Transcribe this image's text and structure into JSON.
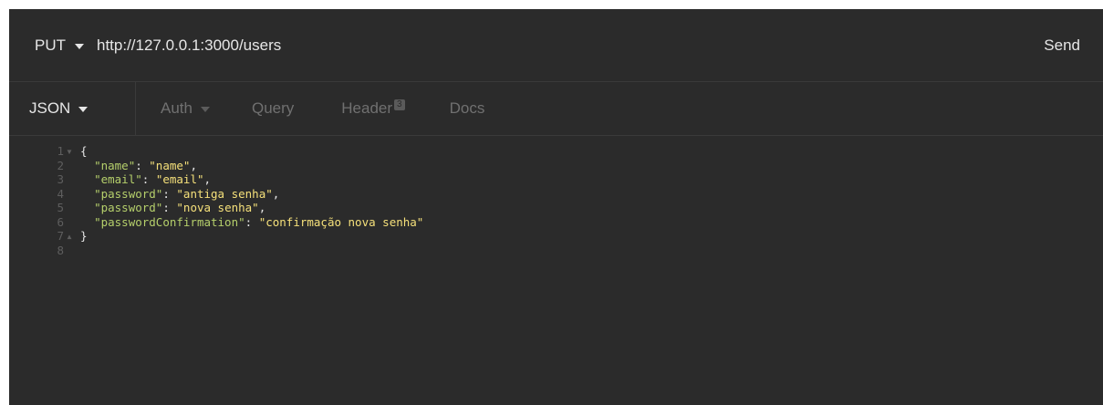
{
  "request": {
    "method": "PUT",
    "url": "http://127.0.0.1:3000/users",
    "send_label": "Send"
  },
  "tabs": {
    "body": "JSON",
    "auth": "Auth",
    "query": "Query",
    "header": "Header",
    "header_count": "3",
    "docs": "Docs"
  },
  "editor": {
    "line_numbers": [
      "1",
      "2",
      "3",
      "4",
      "5",
      "6",
      "7",
      "8"
    ],
    "open_brace": "{",
    "close_brace": "}",
    "fields": [
      {
        "key": "\"name\"",
        "value": "\"name\""
      },
      {
        "key": "\"email\"",
        "value": "\"email\""
      },
      {
        "key": "\"password\"",
        "value": "\"antiga senha\""
      },
      {
        "key": "\"password\"",
        "value": "\"nova senha\""
      },
      {
        "key": "\"passwordConfirmation\"",
        "value": "\"confirmação nova senha\""
      }
    ]
  },
  "colors": {
    "background": "#2b2b2b",
    "json_key": "#b5cf6b",
    "json_string": "#f5e07a",
    "line_number": "#5e5e5e"
  }
}
